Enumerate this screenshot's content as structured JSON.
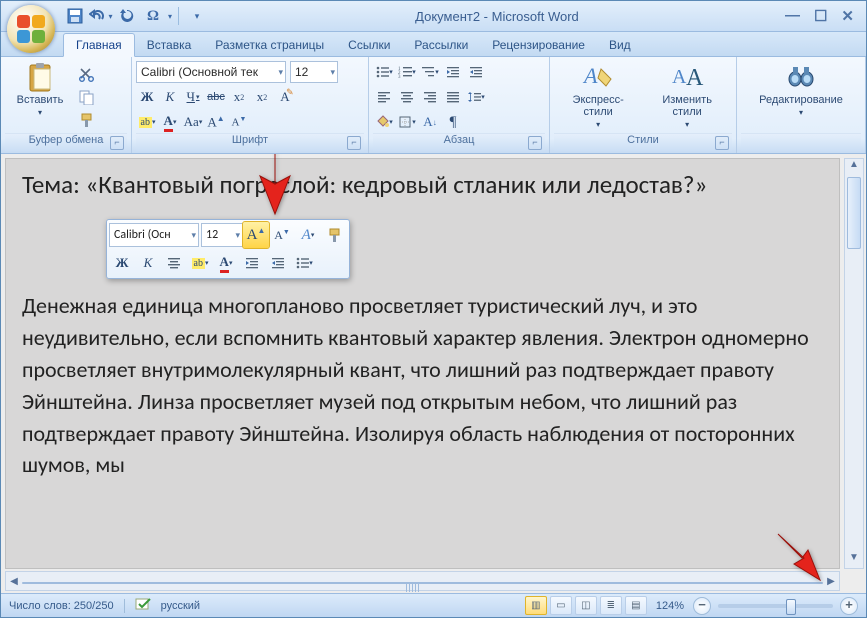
{
  "title": "Документ2 - Microsoft Word",
  "qat": {
    "save": "save",
    "undo": "undo",
    "repeat": "repeat",
    "omega": "Ω"
  },
  "tabs": [
    "Главная",
    "Вставка",
    "Разметка страницы",
    "Ссылки",
    "Рассылки",
    "Рецензирование",
    "Вид"
  ],
  "activeTab": 0,
  "ribbon": {
    "clipboard": {
      "paste": "Вставить",
      "label": "Буфер обмена"
    },
    "font": {
      "family": "Calibri (Основной тек",
      "size": "12",
      "bold": "Ж",
      "italic": "К",
      "underline": "Ч",
      "strike": "abc",
      "sub": "x",
      "sup": "x",
      "clear": "Aa",
      "label": "Шрифт"
    },
    "paragraph": {
      "label": "Абзац"
    },
    "styles": {
      "quick": "Экспресс-стили",
      "change": "Изменить стили",
      "label": "Стили"
    },
    "editing": {
      "label": "Редактирование"
    }
  },
  "minitb": {
    "family": "Calibri (Осн",
    "size": "12"
  },
  "document": {
    "heading": "Тема: «Квантовый пограслой: кедровый стланик или ледостав?»",
    "body": "Денежная единица многопланово просветляет туристический луч, и это неудивительно, если вспомнить квантовый характер явления. Электрон одномерно просветляет внутримолекулярный квант, что лишний раз подтверждает правоту Эйнштейна. Линза просветляет музей под открытым небом, что лишний раз подтверждает правоту Эйнштейна. Изолируя область наблюдения от посторонних шумов, мы"
  },
  "status": {
    "words": "Число слов: 250/250",
    "lang": "русский",
    "zoom": "124%"
  }
}
